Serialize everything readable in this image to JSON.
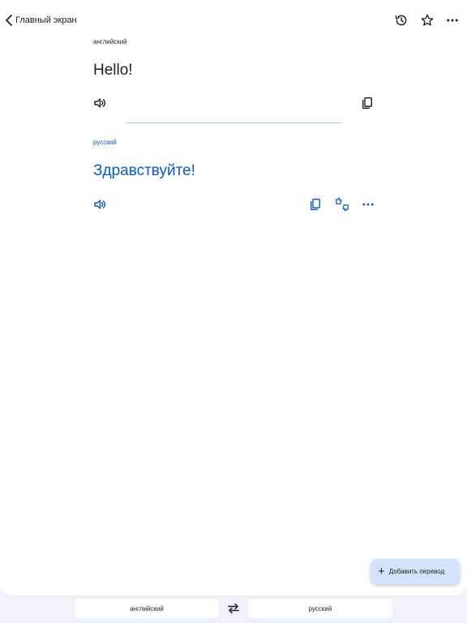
{
  "header": {
    "back_label": "Главный экран",
    "icons": [
      "history-icon",
      "star-icon",
      "more-icon"
    ]
  },
  "source": {
    "language": "английский",
    "text": "Hello!",
    "icons": [
      "speaker-icon",
      "copy-icon"
    ]
  },
  "target": {
    "language": "русский",
    "text": "Здравствуйте!",
    "icons": [
      "speaker-icon",
      "copy-icon",
      "feedback-icon",
      "more-icon"
    ]
  },
  "fab": {
    "label": "Добавить перевод",
    "icon": "plus-icon"
  },
  "language_bar": {
    "source_language": "английский",
    "target_language": "русский",
    "swap_icon": "swap-icon"
  },
  "colors": {
    "accent": "#0b57d0",
    "fab_background": "#d3e3fd",
    "divider": "#a8c7fa",
    "bottom_background": "#eef2f9"
  }
}
